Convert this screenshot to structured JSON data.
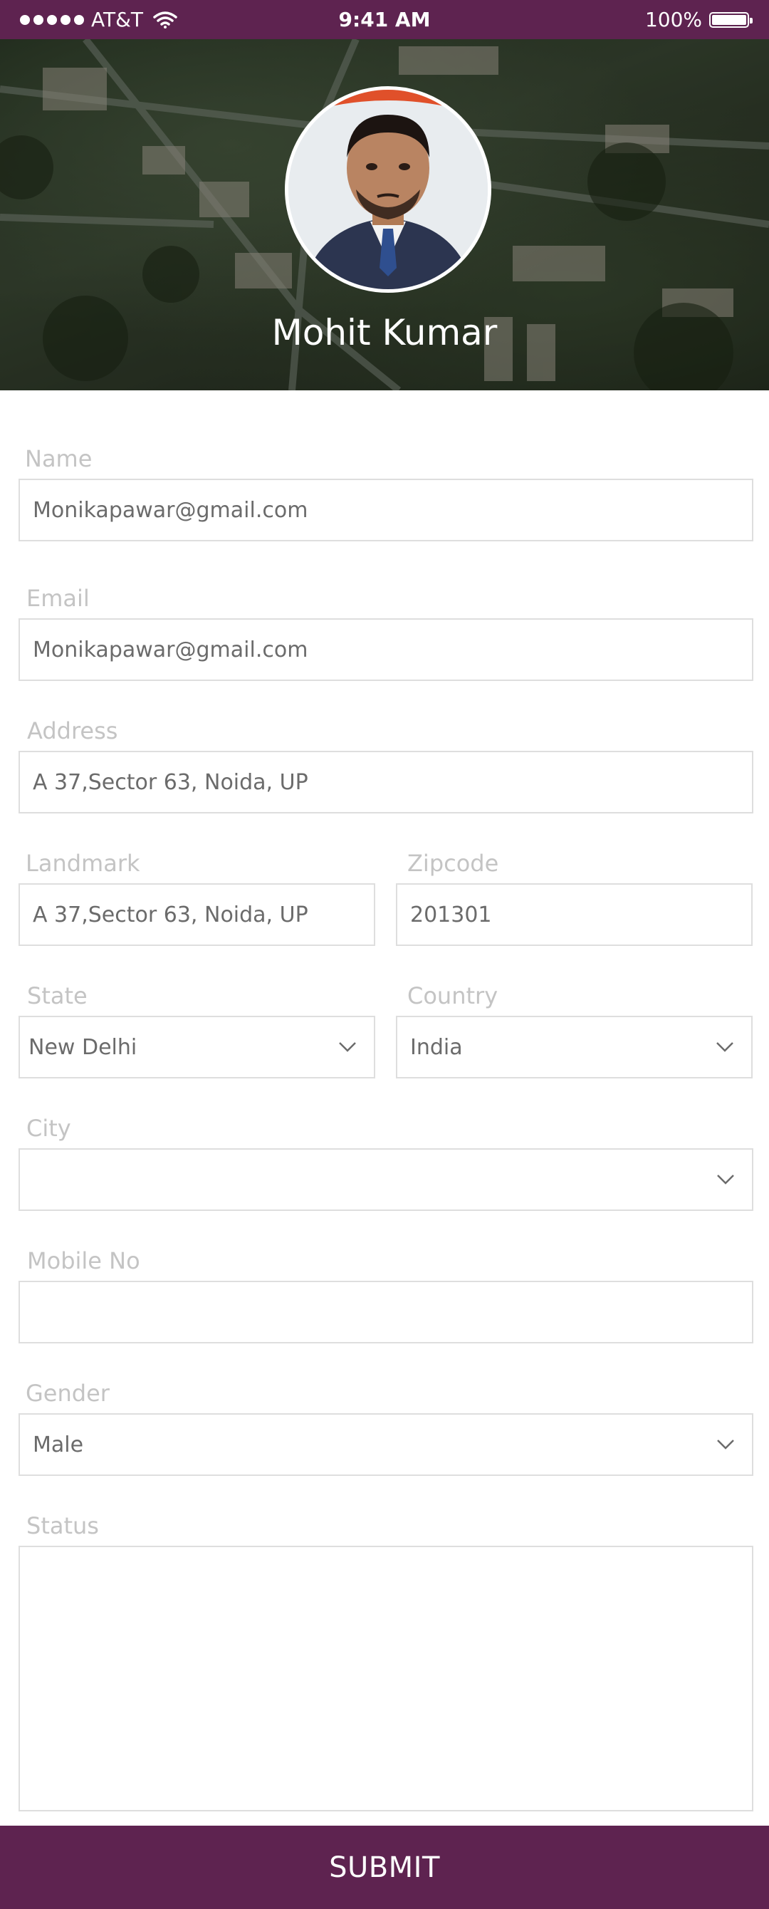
{
  "status_bar": {
    "carrier": "AT&T",
    "time": "9:41 AM",
    "battery": "100%",
    "signal_icon": "signal-dots-icon",
    "wifi_icon": "wifi-icon",
    "battery_icon": "battery-icon"
  },
  "profile": {
    "name": "Mohit Kumar"
  },
  "form": {
    "name": {
      "label": "Name",
      "value": "Monikapawar@gmail.com"
    },
    "email": {
      "label": "Email",
      "value": "Monikapawar@gmail.com"
    },
    "address": {
      "label": "Address",
      "value": "A 37,Sector 63, Noida, UP"
    },
    "landmark": {
      "label": "Landmark",
      "value": "A 37,Sector 63, Noida, UP"
    },
    "zipcode": {
      "label": "Zipcode",
      "value": "201301"
    },
    "state": {
      "label": "State",
      "value": "New Delhi"
    },
    "country": {
      "label": "Country",
      "value": "India"
    },
    "city": {
      "label": "City",
      "value": ""
    },
    "mobile": {
      "label": "Mobile No",
      "value": ""
    },
    "gender": {
      "label": "Gender",
      "value": "Male"
    },
    "status": {
      "label": "Status",
      "value": ""
    }
  },
  "submit_label": "SUBMIT",
  "colors": {
    "brand": "#5e2350",
    "label": "#c4c4c4",
    "field_border": "#dedede",
    "field_text": "#6b6b6b"
  }
}
